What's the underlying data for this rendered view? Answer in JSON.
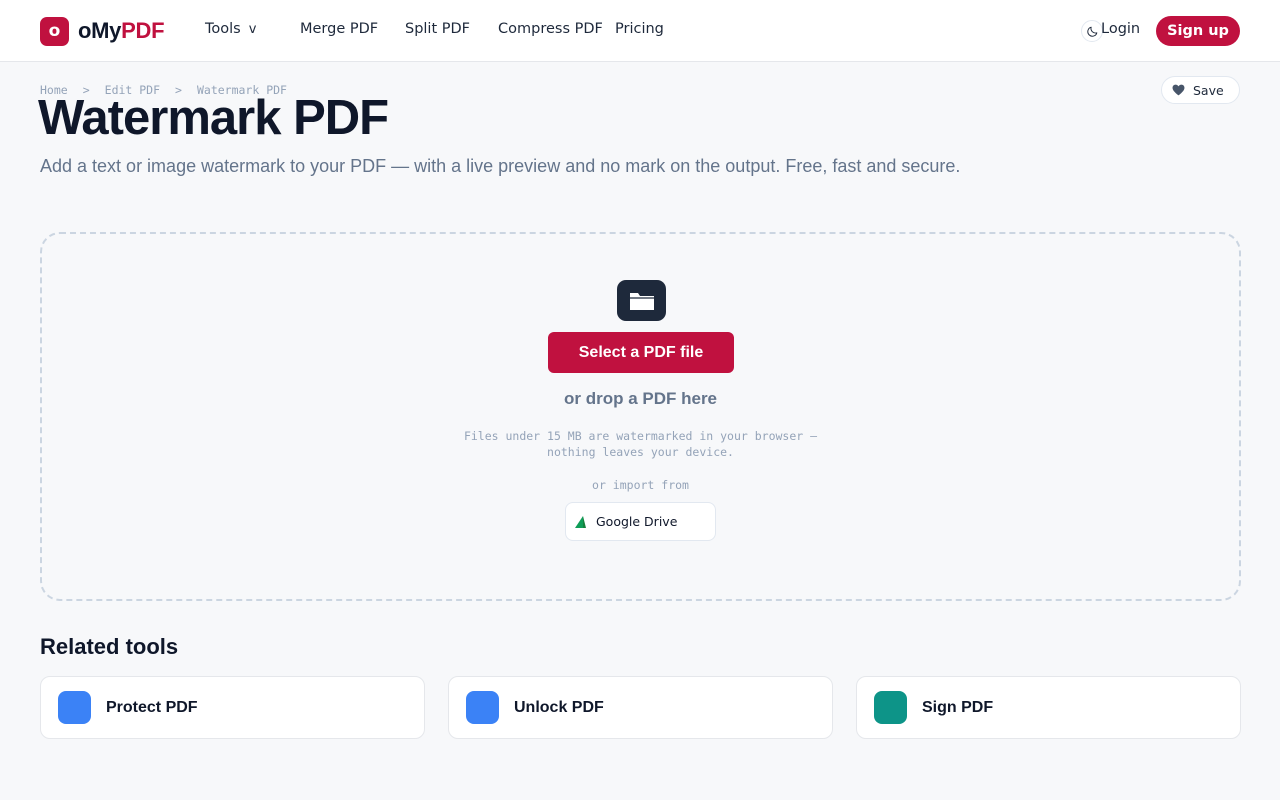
{
  "header": {
    "logo_mark": "o",
    "logo_text_main": "oMy",
    "logo_text_accent": "PDF",
    "nav": {
      "tools": "Tools",
      "tools_chevron": "v",
      "merge": "Merge PDF",
      "split": "Split PDF",
      "compress": "Compress PDF",
      "pricing": "Pricing"
    },
    "theme_icon": "moon-icon",
    "login": "Login",
    "signup": "Sign up"
  },
  "breadcrumb": {
    "items": [
      "Home",
      "Edit PDF",
      "Watermark PDF"
    ],
    "separator": ">"
  },
  "save_button": {
    "label": "Save",
    "icon": "heart-icon"
  },
  "page": {
    "title": "Watermark PDF",
    "subtitle": "Add a text or image watermark to your PDF — with a live preview and no mark on the output. Free, fast and secure."
  },
  "dropzone": {
    "icon": "folder-icon",
    "select_label": "Select a PDF file",
    "drop_text": "or drop a PDF here",
    "note_line1": "Files under 15 MB are watermarked in your browser —",
    "note_line2": "nothing leaves your device.",
    "import_label": "or import from",
    "gdrive_label": "Google Drive",
    "gdrive_icon": "google-drive-icon"
  },
  "related": {
    "heading": "Related tools",
    "tools": [
      {
        "name": "Protect PDF",
        "color": "#3b82f6"
      },
      {
        "name": "Unlock PDF",
        "color": "#3b82f6"
      },
      {
        "name": "Sign PDF",
        "color": "#0d9488"
      }
    ]
  },
  "colors": {
    "brand": "#c0113f",
    "text": "#0f172a",
    "muted": "#64748b",
    "border": "#e5e7eb"
  }
}
